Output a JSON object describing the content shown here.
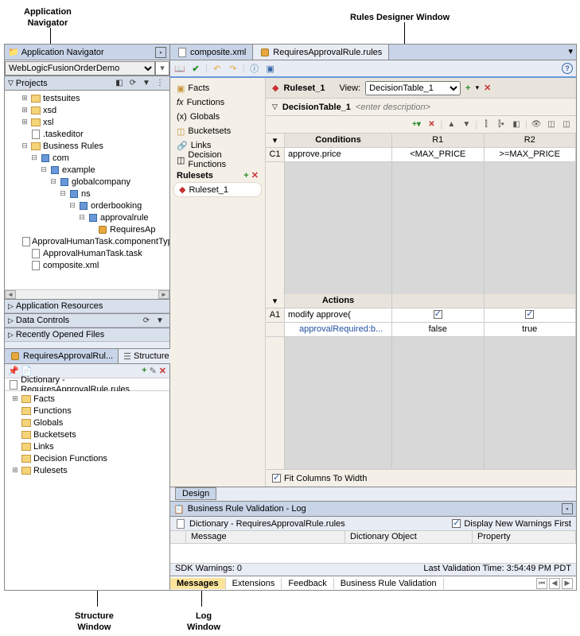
{
  "callouts": {
    "appNav1": "Application",
    "appNav2": "Navigator",
    "rulesDesigner": "Rules Designer Window",
    "structWin1": "Structure",
    "structWin2": "Window",
    "logWin1": "Log",
    "logWin2": "Window"
  },
  "nav": {
    "title": "Application Navigator",
    "appSelected": "WebLogicFusionOrderDemo",
    "projectsLabel": "Projects",
    "tree": {
      "testsuites": "testsuites",
      "xsd": "xsd",
      "xsl": "xsl",
      "taskeditor": ".taskeditor",
      "businessRules": "Business Rules",
      "com": "com",
      "example": "example",
      "globalcompany": "globalcompany",
      "ns": "ns",
      "orderbooking": "orderbooking",
      "approvalrule": "approvalrule",
      "requiresAp": "RequiresAp",
      "approvalHumanTaskComp": "ApprovalHumanTask.componentType",
      "approvalHumanTask": "ApprovalHumanTask.task",
      "compositeXml": "composite.xml"
    },
    "accordion": {
      "appResources": "Application Resources",
      "dataControls": "Data Controls",
      "recentlyOpened": "Recently Opened Files"
    }
  },
  "struct": {
    "tab1": "RequiresApprovalRul...",
    "tab2": "Structure",
    "dictTitle": "Dictionary - RequiresApprovalRule.rules",
    "items": [
      "Facts",
      "Functions",
      "Globals",
      "Bucketsets",
      "Links",
      "Decision Functions",
      "Rulesets"
    ]
  },
  "editor": {
    "tabs": {
      "composite": "composite.xml",
      "requiresApproval": "RequiresApprovalRule.rules"
    },
    "sidebar": {
      "facts": "Facts",
      "functions": "Functions",
      "globals": "Globals",
      "bucketsets": "Bucketsets",
      "links": "Links",
      "decisionFunctions": "Decision Functions",
      "rulesetsTitle": "Rulesets",
      "ruleset1": "Ruleset_1"
    },
    "rulesetHeader": {
      "title": "Ruleset_1",
      "viewLabel": "View:",
      "decisionTable": "DecisionTable_1"
    },
    "dtHeader": {
      "title": "DecisionTable_1",
      "placeholder": "<enter description>"
    },
    "table": {
      "conditionsLabel": "Conditions",
      "c1": "C1",
      "condText": "approve.price",
      "r1": "R1",
      "r2": "R2",
      "r1val": "<MAX_PRICE",
      "r2val": ">=MAX_PRICE",
      "actionsLabel": "Actions",
      "a1": "A1",
      "actText": "modify approve(",
      "approvalRequired": "approvalRequired:b...",
      "falseVal": "false",
      "trueVal": "true"
    },
    "fitColumns": "Fit Columns To Width",
    "designTab": "Design"
  },
  "log": {
    "title": "Business Rule Validation - Log",
    "dictLine": "Dictionary - RequiresApprovalRule.rules",
    "displayNew": "Display New Warnings First",
    "colMessage": "Message",
    "colDictObj": "Dictionary Object",
    "colProperty": "Property",
    "sdkWarnings": "SDK Warnings: 0",
    "lastValidation": "Last Validation Time: 3:54:49 PM PDT",
    "tabMessages": "Messages",
    "tabExtensions": "Extensions",
    "tabFeedback": "Feedback",
    "tabBRV": "Business Rule Validation"
  }
}
